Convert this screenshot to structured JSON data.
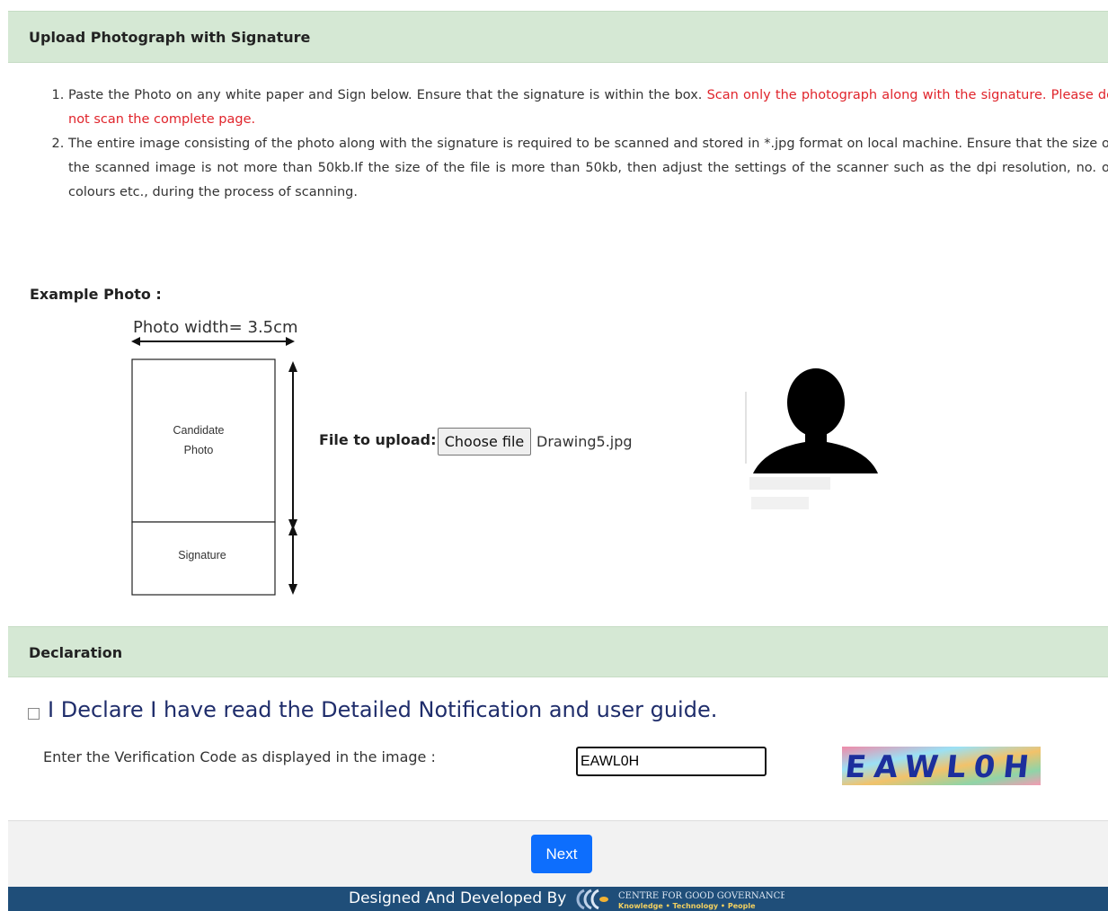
{
  "upload_section": {
    "title": "Upload Photograph with Signature",
    "instructions": [
      {
        "text": "Paste the Photo on any white paper and Sign below. Ensure that the signature is within the box. ",
        "highlight": "Scan only the photograph along with the signature. Please do not scan the complete page."
      },
      {
        "text": "The entire image consisting of the photo along with the signature is required to be scanned and stored in *.jpg format on local machine. Ensure that the size of the scanned image is not more than 50kb.If the size of the file is more than 50kb, then adjust the settings of the scanner such as the dpi resolution, no. of colours etc., during the process of scanning.",
        "highlight": ""
      }
    ],
    "example_label": "Example Photo :",
    "example_diagram": {
      "width_label": "Photo width= 3.5cm",
      "photo_label_line1": "Candidate",
      "photo_label_line2": "Photo",
      "signature_label": "Signature"
    },
    "file_label": "File to upload:",
    "required_marker": "*",
    "choose_file_label": "Choose file",
    "file_name": "Drawing5.jpg"
  },
  "declaration_section": {
    "title": "Declaration",
    "checkbox_label": "I Declare I have read the Detailed Notification and user guide.",
    "checkbox_checked": false,
    "verification_label": "Enter the Verification Code as displayed in the image :",
    "verification_value": "EAWL0H",
    "captcha_text": "EAWL0H"
  },
  "actions": {
    "next_label": "Next"
  },
  "footer": {
    "designed_by": "Designed And Developed By",
    "logo_line1": "CENTRE FOR GOOD GOVERNANCE",
    "logo_line2": "Knowledge • Technology • People"
  },
  "colors": {
    "section_header_bg": "#d5e8d4",
    "highlight_red": "#e0242b",
    "next_button": "#0d6efd",
    "footer_bg": "#1f4e79",
    "declaration_text": "#1f2d6b"
  }
}
